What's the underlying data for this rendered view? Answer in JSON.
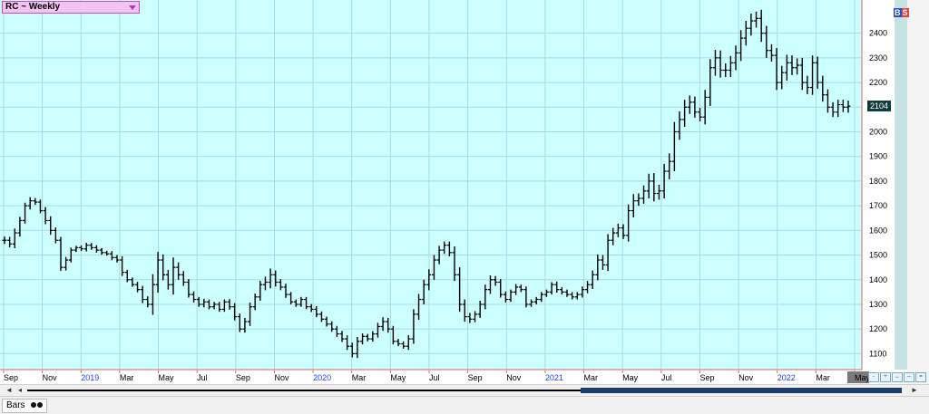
{
  "header": {
    "title": "RC ~ Weekly"
  },
  "badges": {
    "b": "B",
    "s": "S"
  },
  "last_price": "2104",
  "bottom": {
    "tab_label": "Bars"
  },
  "colors": {
    "plot_bg": "#ccffff",
    "grid": "#a8dcdc",
    "bars": "#000000",
    "divider_red": "#e06060",
    "year_label": "#2040ff",
    "month_label": "#000000"
  },
  "chart_data": {
    "type": "ohlc-bar",
    "symbol": "RC",
    "interval": "Weekly",
    "last_value": 2104,
    "ylim": [
      1050,
      2520
    ],
    "y_ticks": [
      1100,
      1200,
      1300,
      1400,
      1500,
      1600,
      1700,
      1800,
      1900,
      2000,
      2100,
      2200,
      2300,
      2400
    ],
    "x_labels": [
      {
        "label": "Sep",
        "kind": "month"
      },
      {
        "label": "Nov",
        "kind": "month"
      },
      {
        "label": "2019",
        "kind": "year"
      },
      {
        "label": "Mar",
        "kind": "month"
      },
      {
        "label": "May",
        "kind": "month"
      },
      {
        "label": "Jul",
        "kind": "month"
      },
      {
        "label": "Sep",
        "kind": "month"
      },
      {
        "label": "Nov",
        "kind": "month"
      },
      {
        "label": "2020",
        "kind": "year"
      },
      {
        "label": "Mar",
        "kind": "month"
      },
      {
        "label": "May",
        "kind": "month"
      },
      {
        "label": "Jul",
        "kind": "month"
      },
      {
        "label": "Sep",
        "kind": "month"
      },
      {
        "label": "Nov",
        "kind": "month"
      },
      {
        "label": "2021",
        "kind": "year"
      },
      {
        "label": "Mar",
        "kind": "month"
      },
      {
        "label": "May",
        "kind": "month"
      },
      {
        "label": "Jul",
        "kind": "month"
      },
      {
        "label": "Sep",
        "kind": "month"
      },
      {
        "label": "Nov",
        "kind": "month"
      },
      {
        "label": "2022",
        "kind": "year"
      },
      {
        "label": "Mar",
        "kind": "month"
      },
      {
        "label": "May",
        "kind": "month"
      }
    ],
    "closes": [
      1560,
      1545,
      1590,
      1640,
      1700,
      1720,
      1715,
      1680,
      1640,
      1600,
      1560,
      1450,
      1480,
      1520,
      1530,
      1525,
      1540,
      1530,
      1520,
      1510,
      1505,
      1490,
      1480,
      1430,
      1400,
      1380,
      1360,
      1320,
      1300,
      1380,
      1480,
      1420,
      1380,
      1450,
      1420,
      1390,
      1340,
      1320,
      1300,
      1310,
      1290,
      1300,
      1280,
      1310,
      1290,
      1250,
      1200,
      1230,
      1290,
      1330,
      1380,
      1390,
      1420,
      1390,
      1370,
      1340,
      1310,
      1300,
      1320,
      1290,
      1280,
      1260,
      1240,
      1220,
      1200,
      1180,
      1160,
      1130,
      1100,
      1150,
      1170,
      1160,
      1180,
      1210,
      1230,
      1200,
      1150,
      1140,
      1130,
      1160,
      1260,
      1320,
      1380,
      1420,
      1480,
      1520,
      1540,
      1510,
      1420,
      1300,
      1250,
      1240,
      1260,
      1300,
      1360,
      1400,
      1390,
      1340,
      1320,
      1350,
      1370,
      1360,
      1300,
      1310,
      1320,
      1340,
      1350,
      1380,
      1360,
      1350,
      1340,
      1330,
      1340,
      1360,
      1380,
      1420,
      1480,
      1460,
      1560,
      1590,
      1610,
      1580,
      1680,
      1720,
      1730,
      1760,
      1800,
      1750,
      1760,
      1840,
      1880,
      2000,
      2050,
      2100,
      2120,
      2080,
      2060,
      2140,
      2260,
      2300,
      2250,
      2250,
      2280,
      2320,
      2380,
      2420,
      2450,
      2460,
      2400,
      2330,
      2310,
      2200,
      2240,
      2280,
      2260,
      2270,
      2200,
      2180,
      2280,
      2200,
      2150,
      2100,
      2080,
      2110,
      2100,
      2104
    ],
    "ranges": [
      60,
      55,
      70,
      60,
      50,
      60,
      45,
      40,
      60,
      70,
      50,
      55,
      50,
      40,
      30,
      35,
      40,
      35,
      40,
      35,
      30,
      45,
      40,
      60,
      40,
      35,
      45,
      60,
      50,
      170,
      130,
      90,
      80,
      160,
      80,
      60,
      50,
      50,
      40,
      50,
      40,
      40,
      40,
      40,
      45,
      60,
      50,
      60,
      70,
      55,
      60,
      90,
      100,
      70,
      50,
      55,
      40,
      40,
      40,
      40,
      45,
      50,
      45,
      40,
      45,
      50,
      50,
      60,
      60,
      70,
      50,
      40,
      45,
      60,
      70,
      60,
      50,
      40,
      40,
      60,
      80,
      90,
      80,
      90,
      80,
      70,
      60,
      60,
      100,
      120,
      80,
      60,
      50,
      60,
      80,
      70,
      60,
      50,
      50,
      40,
      50,
      40,
      50,
      40,
      40,
      40,
      40,
      40,
      50,
      40,
      40,
      40,
      40,
      50,
      60,
      70,
      90,
      80,
      100,
      80,
      70,
      60,
      100,
      110,
      80,
      90,
      120,
      130,
      100,
      120,
      130,
      160,
      130,
      120,
      110,
      90,
      70,
      120,
      140,
      130,
      120,
      110,
      110,
      120,
      130,
      120,
      120,
      110,
      140,
      120,
      100,
      120,
      110,
      130,
      120,
      110,
      120,
      110,
      120,
      100,
      110,
      90,
      80,
      80,
      80,
      90
    ]
  }
}
